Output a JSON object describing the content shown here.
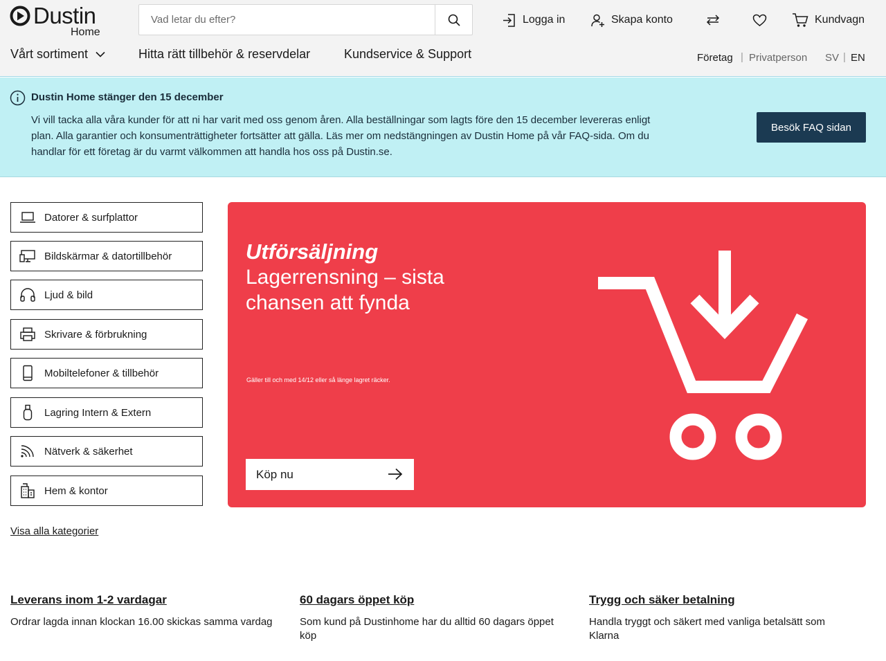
{
  "header": {
    "logo_text": "Dustin",
    "logo_sub": "Home",
    "search_placeholder": "Vad letar du efter?",
    "login": "Logga in",
    "create_account": "Skapa konto",
    "cart": "Kundvagn"
  },
  "nav": {
    "assortment": "Vårt sortiment",
    "accessories": "Hitta rätt tillbehör & reservdelar",
    "support": "Kundservice & Support",
    "business": "Företag",
    "private": "Privatperson",
    "lang_sv": "SV",
    "lang_en": "EN",
    "separator": "|"
  },
  "banner": {
    "title": "Dustin Home stänger den 15 december",
    "body": "Vi vill tacka alla våra kunder för att ni har varit med oss genom åren. Alla beställningar som lagts före den 15 december levereras enligt plan. Alla garantier och konsumenträttigheter fortsätter att gälla. Läs mer om nedstängningen av Dustin Home på vår FAQ-sida. Om du handlar för ett företag är du varmt välkommen att handla hos oss på Dustin.se.",
    "faq_button": "Besök FAQ sidan"
  },
  "categories": [
    {
      "label": "Datorer & surfplattor",
      "icon": "laptop-icon"
    },
    {
      "label": "Bildskärmar & datortillbehör",
      "icon": "monitor-icon"
    },
    {
      "label": "Ljud & bild",
      "icon": "headphones-icon"
    },
    {
      "label": "Skrivare & förbrukning",
      "icon": "printer-icon"
    },
    {
      "label": "Mobiltelefoner & tillbehör",
      "icon": "phone-icon"
    },
    {
      "label": "Lagring Intern & Extern",
      "icon": "usb-stick-icon"
    },
    {
      "label": "Nätverk & säkerhet",
      "icon": "wifi-icon"
    },
    {
      "label": "Hem & kontor",
      "icon": "building-icon"
    }
  ],
  "show_all_categories": "Visa alla kategorier",
  "hero": {
    "headline": "Utförsäljning",
    "subheadline": "Lagerrensning – sista chansen att fynda",
    "fine_print": "Gäller till och med 14/12 eller så länge lagret räcker.",
    "button": "Köp nu",
    "background_color": "#ef3e4a"
  },
  "usps": [
    {
      "title": "Leverans inom 1-2 vardagar",
      "text": "Ordrar lagda innan klockan 16.00 skickas samma vardag"
    },
    {
      "title": "60 dagars öppet köp",
      "text": "Som kund på Dustinhome har du alltid 60 dagars öppet köp"
    },
    {
      "title": "Trygg och säker betalning",
      "text": "Handla tryggt och säkert med vanliga betalsätt som Klarna"
    }
  ]
}
